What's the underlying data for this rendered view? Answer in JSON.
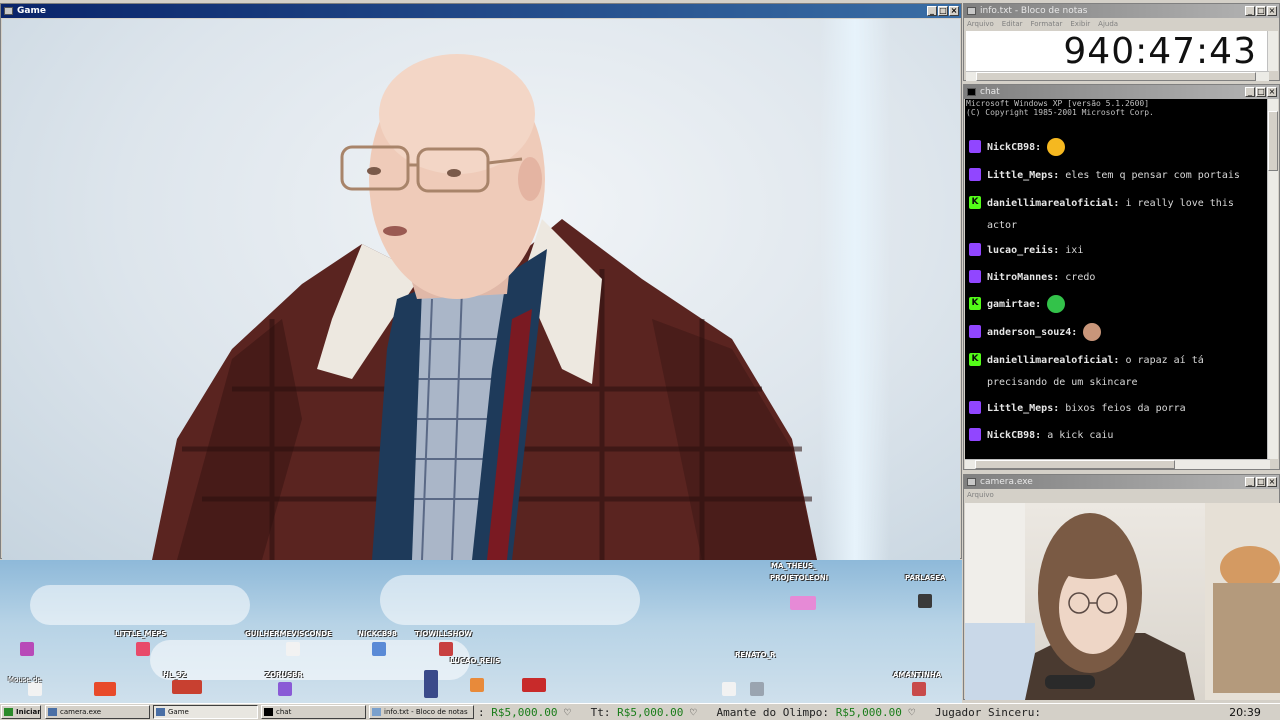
{
  "game_window": {
    "title": "Game"
  },
  "notes_window": {
    "title": "info.txt - Bloco de notas",
    "menu": [
      "Arquivo",
      "Editar",
      "Formatar",
      "Exibir",
      "Ajuda"
    ],
    "timer": "940:47:43"
  },
  "chat_window": {
    "title": "chat",
    "console_header": [
      "Microsoft Windows XP [versão 5.1.2600]",
      "(C) Copyright 1985-2001 Microsoft Corp."
    ],
    "messages": [
      {
        "platform": "twitch",
        "user": "NickCB98:",
        "text": "",
        "emote": "shocked-emote"
      },
      {
        "platform": "twitch",
        "user": "Little_Meps:",
        "text": "eles tem q pensar com portais"
      },
      {
        "platform": "kick",
        "user": "daniellimarealoficial:",
        "text": "i really love this",
        "text2": "actor"
      },
      {
        "platform": "twitch",
        "user": "lucao_reiis:",
        "text": "ixi"
      },
      {
        "platform": "twitch",
        "user": "NitroMannes:",
        "text": "credo"
      },
      {
        "platform": "kick",
        "user": "gamirtae:",
        "text": "",
        "emote": "green-emote"
      },
      {
        "platform": "twitch",
        "user": "anderson_souz4:",
        "text": "",
        "emote": "face-emote"
      },
      {
        "platform": "kick",
        "user": "daniellimarealoficial:",
        "text": "o rapaz aí tá",
        "text2": "precisando de um skincare"
      },
      {
        "platform": "twitch",
        "user": "Little_Meps:",
        "text": "bixos feios da porra"
      },
      {
        "platform": "twitch",
        "user": "NickCB98:",
        "text": "a kick caiu"
      }
    ]
  },
  "camera_window": {
    "title": "camera.exe",
    "menu": "Arquivo"
  },
  "stage": {
    "players": [
      {
        "name": "MA_THEUS_",
        "color": "#e68ad6"
      },
      {
        "name": "PROJETOLEONI",
        "color": "#f0a0c8"
      },
      {
        "name": "PARLASEA",
        "color": "#ffffff"
      },
      {
        "name": "LITTLE_MEPS",
        "color": "#e84a6a"
      },
      {
        "name": "GUILHERMEVISCONDE",
        "color": "#f2f2f2"
      },
      {
        "name": "NICKCB98",
        "color": "#5a8ad6"
      },
      {
        "name": "TIOWILLSHOW",
        "color": "#c84040"
      },
      {
        "name": "LUCAO_REIIS",
        "color": "#e88a3a"
      },
      {
        "name": "HL_92",
        "color": "#4a8ae8"
      },
      {
        "name": "ZORUSBR",
        "color": "#8a5ad6"
      },
      {
        "name": "RENATO_R",
        "color": "#e0e0e0"
      },
      {
        "name": "AMANTINHA",
        "color": "#c84a4a"
      }
    ],
    "corner_label": "Mouse de"
  },
  "taskbar": {
    "start": "Iniciar",
    "items": [
      "camera.exe",
      "Game",
      "chat",
      "info.txt - Bloco de notas"
    ],
    "ticker": [
      {
        "label": "",
        "value": "R$5,000.00"
      },
      {
        "label": "Tt:",
        "value": "R$5,000.00"
      },
      {
        "label": "Amante do Olimpo:",
        "value": "R$5,000.00"
      },
      {
        "label": "Jugador Sinceru:",
        "value": ""
      }
    ],
    "clock": "20:39"
  },
  "colors": {
    "titlebar_active": "#0a246a",
    "twitch": "#9146ff",
    "kick": "#53fc18",
    "money": "#1a7d1a"
  }
}
